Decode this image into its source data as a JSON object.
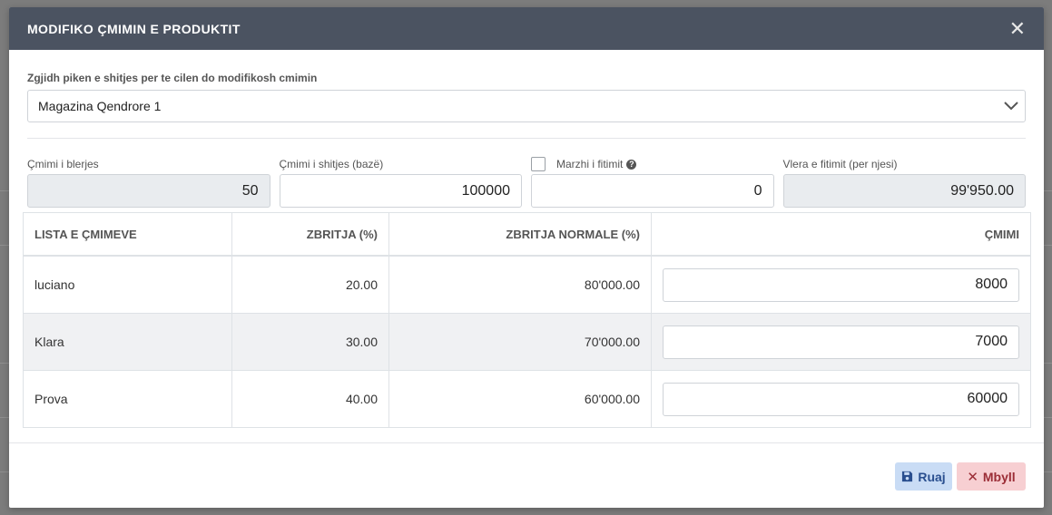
{
  "modal": {
    "title": "MODIFIKO ÇMIMIN E PRODUKTIT"
  },
  "store": {
    "label": "Zgjidh piken e shitjes per te cilen do modifikosh cmimin",
    "value": "Magazina Qendrore 1"
  },
  "fields": {
    "purchase_label": "Çmimi i blerjes",
    "purchase_value": "50",
    "sale_label": "Çmimi i shitjes (bazë)",
    "sale_value": "100000",
    "margin_label": "Marzhi i fitimit",
    "margin_value": "0",
    "profit_label": "Vlera e fitimit (per njesi)",
    "profit_value": "99'950.00"
  },
  "table": {
    "headers": [
      "LISTA E ÇMIMEVE",
      "ZBRITJA (%)",
      "ZBRITJA NORMALE (%)",
      "ÇMIMI"
    ],
    "rows": [
      {
        "name": "luciano",
        "discount": "20.00",
        "normal": "80'000.00",
        "price": "8000"
      },
      {
        "name": "Klara",
        "discount": "30.00",
        "normal": "70'000.00",
        "price": "7000"
      },
      {
        "name": "Prova",
        "discount": "40.00",
        "normal": "60'000.00",
        "price": "60000"
      }
    ]
  },
  "buttons": {
    "save": "Ruaj",
    "close": "Mbyll"
  },
  "icons": {
    "close": "close-icon",
    "chevron": "chevron-down-icon",
    "help": "help-icon",
    "save": "floppy-disk-icon",
    "cancel": "x-icon"
  },
  "colors": {
    "header_bg": "#4b5361",
    "save_bg": "#c9dcf5",
    "close_bg": "#f7cfd2"
  }
}
